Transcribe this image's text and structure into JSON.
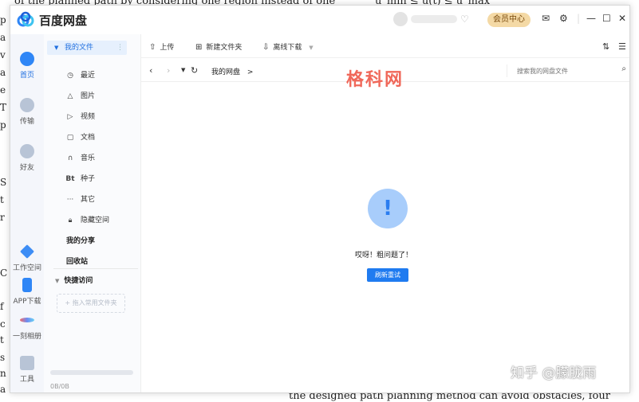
{
  "background": {
    "top_left": "of the planned path by considering one region instead of one",
    "top_right": "u_min ≤ u(t) ≤ u_max",
    "bottom_right": "the designed path planning method can avoid obstacles, four",
    "margin_letters": [
      "p",
      "a",
      "v",
      "a",
      "e",
      "T",
      "p",
      "S",
      "t",
      "r",
      "C",
      "f",
      "c",
      "t",
      "s",
      "n",
      "a",
      "f",
      "a"
    ]
  },
  "app": {
    "title": "百度网盘",
    "vip_label": "会员中心",
    "watermark": "格科网",
    "signature": "知乎 @朦胧雨"
  },
  "leftnav": [
    {
      "label": "首页",
      "icon": "cloud-icon"
    },
    {
      "label": "传输",
      "icon": "transfer-icon"
    },
    {
      "label": "好友",
      "icon": "friends-icon"
    },
    {
      "label": "工作空间",
      "icon": "workspace-icon"
    },
    {
      "label": "APP下载",
      "icon": "phone-icon"
    },
    {
      "label": "一刻相册",
      "icon": "album-icon"
    },
    {
      "label": "工具",
      "icon": "tools-icon"
    }
  ],
  "sidebar": {
    "my_files": "我的文件",
    "items": [
      {
        "label": "最近",
        "icon": "clock-icon"
      },
      {
        "label": "图片",
        "icon": "image-icon"
      },
      {
        "label": "视频",
        "icon": "play-icon"
      },
      {
        "label": "文档",
        "icon": "document-icon"
      },
      {
        "label": "音乐",
        "icon": "headphones-icon"
      },
      {
        "label": "种子",
        "icon": "bt-icon"
      },
      {
        "label": "其它",
        "icon": "more-icon"
      },
      {
        "label": "隐藏空间",
        "icon": "lock-icon"
      }
    ],
    "my_share": "我的分享",
    "recycle": "回收站",
    "quick_access": "快捷访问",
    "drag_hint": "+ 拖入常用文件夹",
    "quota": "0B/0B"
  },
  "toolbar": {
    "upload": "上传",
    "new_folder": "新建文件夹",
    "offline_download": "离线下载"
  },
  "address": {
    "crumb": "我的网盘",
    "crumb_sep": ">",
    "search_placeholder": "搜索我的网盘文件"
  },
  "error": {
    "symbol": "!",
    "message": "哎呀！粗问题了！",
    "retry": "刷新重试"
  }
}
